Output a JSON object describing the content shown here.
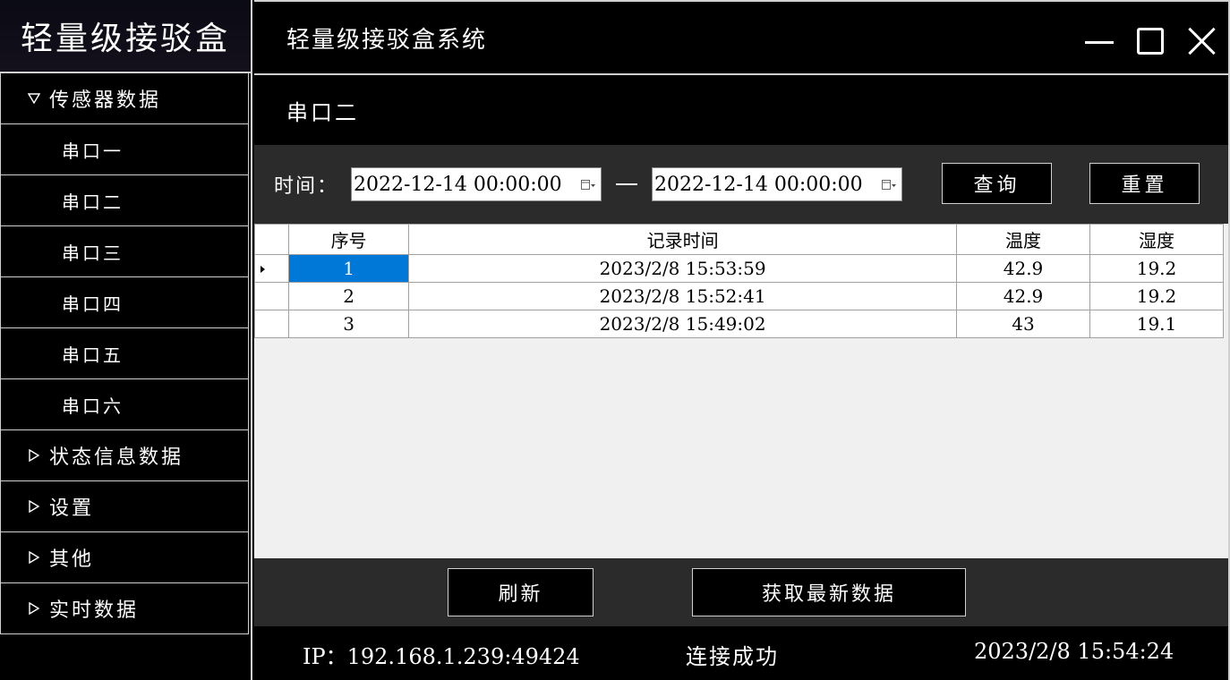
{
  "app": {
    "logo_text": "轻量级接驳盒",
    "window_title": "轻量级接驳盒系统"
  },
  "sidebar": {
    "items": [
      {
        "label": "传感器数据",
        "expanded": true
      },
      {
        "label": "串口一"
      },
      {
        "label": "串口二"
      },
      {
        "label": "串口三"
      },
      {
        "label": "串口四"
      },
      {
        "label": "串口五"
      },
      {
        "label": "串口六"
      },
      {
        "label": "状态信息数据",
        "expanded": false
      },
      {
        "label": "设置",
        "expanded": false
      },
      {
        "label": "其他",
        "expanded": false
      },
      {
        "label": "实时数据",
        "expanded": false
      }
    ]
  },
  "main": {
    "section_title": "串口二",
    "filter": {
      "time_label": "时间：",
      "start_date": "2022-12-14 00:00:00",
      "end_date": "2022-12-14 00:00:00",
      "query_label": "查询",
      "reset_label": "重置"
    },
    "table": {
      "headers": [
        "序号",
        "记录时间",
        "温度",
        "湿度"
      ],
      "rows": [
        [
          "1",
          "2023/2/8 15:53:59",
          "42.9",
          "19.2"
        ],
        [
          "2",
          "2023/2/8 15:52:41",
          "42.9",
          "19.2"
        ],
        [
          "3",
          "2023/2/8 15:49:02",
          "43",
          "19.1"
        ]
      ]
    },
    "actions": {
      "refresh_label": "刷新",
      "fetch_latest_label": "获取最新数据"
    },
    "status": {
      "ip": "IP：192.168.1.239:49424",
      "connection": "连接成功",
      "datetime": "2023/2/8 15:54:24"
    }
  },
  "colors": {
    "selection": "#0078d7",
    "panel": "#2b2b2b",
    "border": "#d0d0d0"
  }
}
